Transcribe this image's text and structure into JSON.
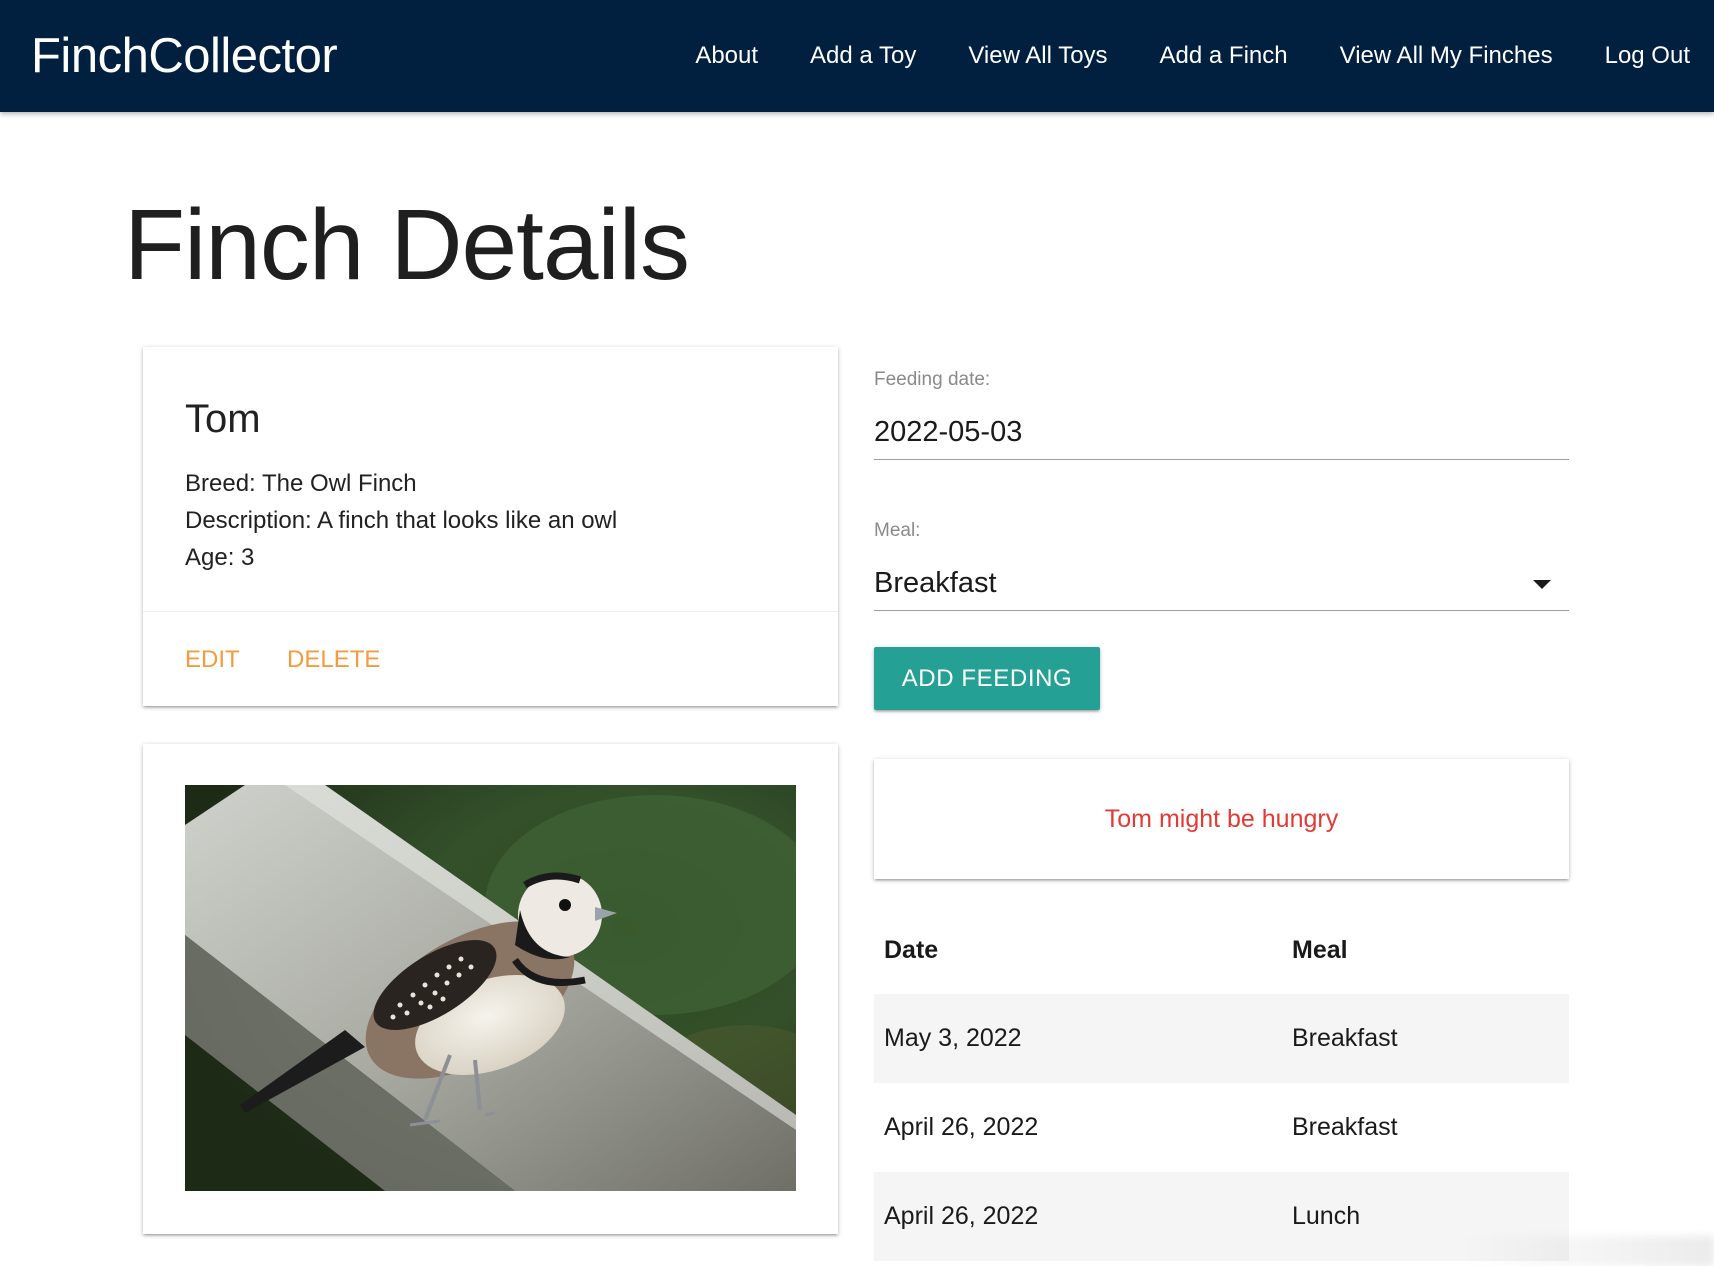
{
  "nav": {
    "brand": "FinchCollector",
    "links": [
      "About",
      "Add a Toy",
      "View All Toys",
      "Add a Finch",
      "View All My Finches",
      "Log Out"
    ],
    "background": "#011f3f"
  },
  "page": {
    "title": "Finch Details"
  },
  "finch": {
    "name": "Tom",
    "breed": "Breed: The Owl Finch",
    "description": "Description: A finch that looks like an owl",
    "age": "Age: 3",
    "actions": {
      "edit": "EDIT",
      "delete": "DELETE"
    }
  },
  "photo": {
    "icon": "owl-finch-photo"
  },
  "feeding_form": {
    "date_label": "Feeding date:",
    "date_value": "2022-05-03",
    "meal_label": "Meal:",
    "meal_value": "Breakfast",
    "submit_label": "ADD FEEDING",
    "button_color": "#25a094"
  },
  "status": {
    "message": "Tom might be hungry",
    "color": "#e53935"
  },
  "feedings": {
    "headers": [
      "Date",
      "Meal"
    ],
    "rows": [
      [
        "May 3, 2022",
        "Breakfast"
      ],
      [
        "April 26, 2022",
        "Breakfast"
      ],
      [
        "April 26, 2022",
        "Lunch"
      ]
    ]
  },
  "colors": {
    "accent": "#f49b3d"
  }
}
